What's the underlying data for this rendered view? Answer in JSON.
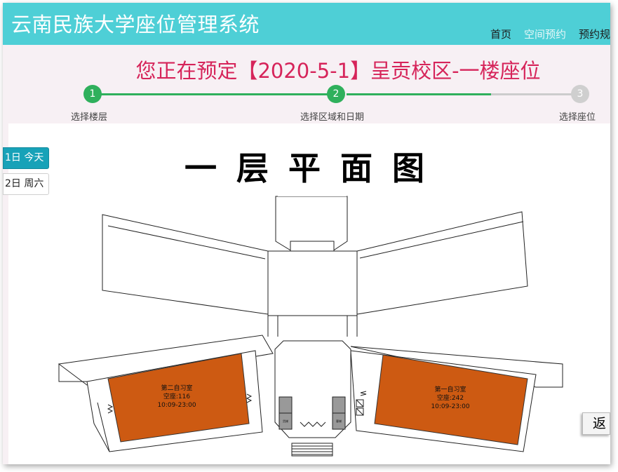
{
  "header": {
    "title": "云南民族大学座位管理系统",
    "nav": [
      {
        "label": "首页",
        "active": false
      },
      {
        "label": "空间预约",
        "active": true
      },
      {
        "label": "预约规",
        "active": false
      }
    ]
  },
  "booking": {
    "title": "您正在预定【2020-5-1】呈贡校区-一楼座位"
  },
  "steps": [
    {
      "number": "1",
      "label": "选择楼层",
      "state": "done"
    },
    {
      "number": "2",
      "label": "选择区域和日期",
      "state": "done"
    },
    {
      "number": "3",
      "label": "选择座位",
      "state": "todo"
    }
  ],
  "dates": [
    {
      "label": "1日 今天",
      "active": true
    },
    {
      "label": "2日 周六",
      "active": false
    }
  ],
  "floorplan": {
    "title": "一层平面图",
    "rooms": [
      {
        "name": "第二自习室",
        "seats": "空座:116",
        "hours": "10:09-23:00"
      },
      {
        "name": "第一自习室",
        "seats": "空座:242",
        "hours": "10:09-23:00"
      }
    ],
    "elevators": [
      "货梯",
      "客梯"
    ],
    "room_color": "#cd5a12"
  },
  "back_label": "返",
  "colors": {
    "header_bg": "#4ecfd6",
    "title_red": "#d6245a",
    "step_green": "#2fb05c",
    "tab_active": "#17a2b8"
  }
}
